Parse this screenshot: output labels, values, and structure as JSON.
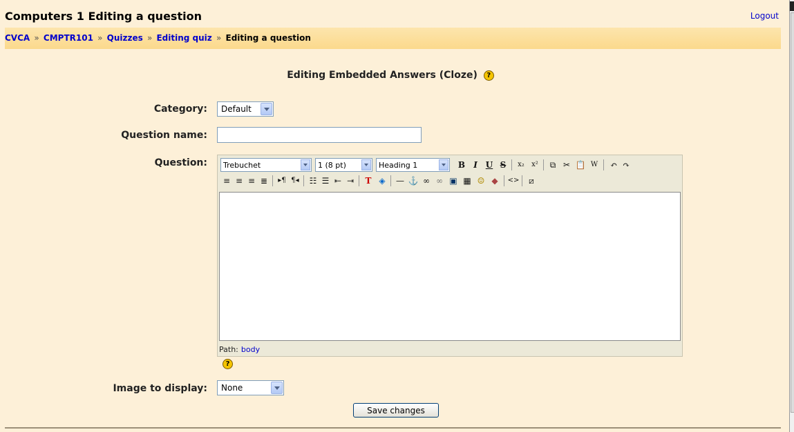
{
  "header": {
    "title": "Computers 1 Editing a question",
    "logout": "Logout"
  },
  "breadcrumb": {
    "items": [
      "CVCA",
      "CMPTR101",
      "Quizzes",
      "Editing quiz"
    ],
    "separator": "»",
    "current": "Editing a question"
  },
  "form": {
    "heading": "Editing Embedded Answers (Cloze)",
    "help_glyph": "?",
    "category_label": "Category:",
    "category_value": "Default",
    "question_name_label": "Question name:",
    "question_name_value": "",
    "question_label": "Question:",
    "image_label": "Image to display:",
    "image_value": "None",
    "save_label": "Save changes"
  },
  "editor": {
    "font_value": "Trebuchet",
    "size_value": "1 (8 pt)",
    "format_value": "Heading 1",
    "path_label": "Path:",
    "path_value": "body",
    "toolbar_row1": [
      "bold-icon",
      "italic-icon",
      "underline-icon",
      "strikethrough-icon",
      "subscript-icon",
      "superscript-icon",
      "copy-icon",
      "cut-icon",
      "paste-icon",
      "paste-word-icon",
      "undo-icon",
      "redo-icon"
    ],
    "toolbar_row2": [
      "align-left-icon",
      "align-center-icon",
      "align-right-icon",
      "justify-icon",
      "ltr-icon",
      "rtl-icon",
      "ordered-list-icon",
      "unordered-list-icon",
      "outdent-icon",
      "indent-icon",
      "text-color-icon",
      "background-color-icon",
      "horizontal-rule-icon",
      "anchor-icon",
      "link-icon",
      "unlink-icon",
      "image-icon",
      "table-icon",
      "smiley-icon",
      "special-char-icon",
      "html-source-icon",
      "fullscreen-icon"
    ]
  },
  "colors": {
    "background": "#fdf0d8",
    "navbar": "#fbd98c",
    "link": "#0000cc"
  }
}
